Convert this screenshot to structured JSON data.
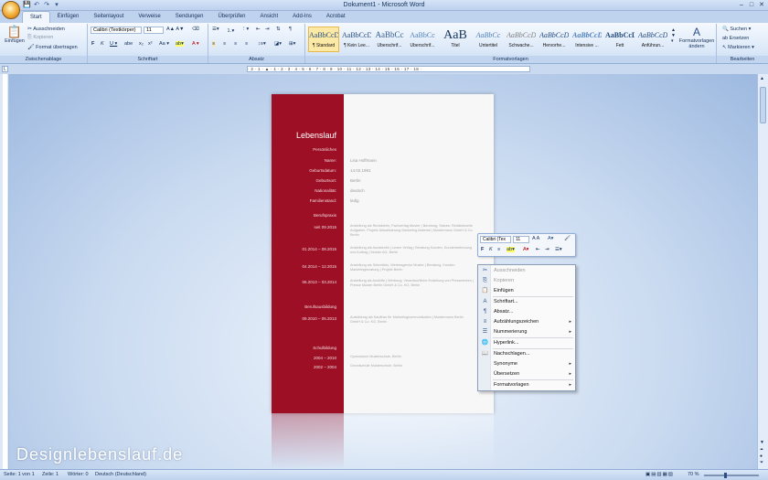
{
  "window": {
    "title": "Dokument1 - Microsoft Word"
  },
  "tabs": [
    "Start",
    "Einfügen",
    "Seitenlayout",
    "Verweise",
    "Sendungen",
    "Überprüfen",
    "Ansicht",
    "Add-Ins",
    "Acrobat"
  ],
  "clipboard": {
    "paste": "Einfügen",
    "cut": "Ausschneiden",
    "copy": "Kopieren",
    "format_painter": "Format übertragen",
    "label": "Zwischenablage"
  },
  "font": {
    "name": "Calibri (Textkörper)",
    "size": "11",
    "label": "Schriftart"
  },
  "paragraph": {
    "label": "Absatz"
  },
  "styles": {
    "label": "Formatvorlagen",
    "items": [
      {
        "preview": "AaBbCcDc",
        "name": "¶ Standard"
      },
      {
        "preview": "AaBbCcDc",
        "name": "¶ Kein Lee..."
      },
      {
        "preview": "AaBbCc",
        "name": "Überschrif..."
      },
      {
        "preview": "AaBbCc",
        "name": "Überschrif..."
      },
      {
        "preview": "AaB",
        "name": "Titel"
      },
      {
        "preview": "AaBbCc",
        "name": "Untertitel"
      },
      {
        "preview": "AaBbCcDc",
        "name": "Schwache..."
      },
      {
        "preview": "AaBbCcDc",
        "name": "Hervorhe..."
      },
      {
        "preview": "AaBbCcDc",
        "name": "Intensive ..."
      },
      {
        "preview": "AaBbCcDc",
        "name": "Fett"
      },
      {
        "preview": "AaBbCcDc",
        "name": "Anführun..."
      }
    ],
    "change": "Formatvorlagen ändern"
  },
  "editing": {
    "find": "Suchen",
    "replace": "Ersetzen",
    "select": "Markieren",
    "label": "Bearbeiten"
  },
  "ruler": "· 2 · 1 · ▲ · 1 · 2 · 3 · 4 · 5 · 6 · 7 · 8 · 9 · 10 · 11 · 12 · 13 · 14 · 15 · 16 · 17 · 18 ·",
  "cv": {
    "title": "Lebenslauf",
    "personal_heading": "Persönliches",
    "personal": [
      {
        "label": "Name:",
        "value": "Lisa Hoffmann"
      },
      {
        "label": "Geburtsdatum:",
        "value": "14.02.1991"
      },
      {
        "label": "Geburtsort:",
        "value": "Berlin"
      },
      {
        "label": "Nationalität:",
        "value": "deutsch"
      },
      {
        "label": "Familienstand:",
        "value": "ledig"
      }
    ],
    "career_heading": "Berufspraxis",
    "career": [
      {
        "date": "seit 09.2015",
        "desc": "Anstellung als Redakterin, Fachverlag Muster | Beratung, Satzes: Redaktionelle Aufgaben, Projekt-Aktualisierung Marketing-Material | Mustermann GmbH & Co. Berlin"
      },
      {
        "date": "01.2014 – 08.2015",
        "desc": "Anstellung als Assistentin | Lesen Verlag | Beratung Kunden, Kundenbetreuung und Auftrag | Muster AG, Berlin"
      },
      {
        "date": "04.2014 – 12.2015",
        "desc": "Anstellung als Sekretärin, Werbeagentur Muster | Beratung, Kunden Marketingberatung | Projekt Berlin"
      },
      {
        "date": "06.2013 – 03.2014",
        "desc": "Anstellung als Aushilfe | Werbung, Verantwortliche Erstellung von Pressetexten | Presse Muster Berlin GmbH & Co. KG, Berlin"
      }
    ],
    "education_heading": "Berufsausbildung",
    "education": [
      {
        "date": "09.2010 – 05.2013",
        "desc": "Ausbildung als Kauffrau für Marketingkommunikation | Mustermann Berlin GmbH & Co. KG, Berlin"
      }
    ],
    "school_heading": "Schulbildung",
    "school": [
      {
        "date": "2004 – 2010",
        "desc": "Gymnasium Musterschule, Berlin"
      },
      {
        "date": "2002 – 2004",
        "desc": "Grundschule Musterschule, Berlin"
      }
    ]
  },
  "mini_toolbar": {
    "font": "Calibri (Tex",
    "size": "11"
  },
  "context_menu": [
    {
      "label": "Ausschneiden",
      "disabled": true,
      "icon": "scissors-icon",
      "glyph": "✂"
    },
    {
      "label": "Kopieren",
      "disabled": true,
      "icon": "copy-icon",
      "glyph": "⎘"
    },
    {
      "label": "Einfügen",
      "disabled": false,
      "icon": "paste-icon",
      "glyph": "📋"
    },
    {
      "label": "Schriftart...",
      "disabled": false,
      "icon": "font-icon",
      "glyph": "A"
    },
    {
      "label": "Absatz...",
      "disabled": false,
      "icon": "paragraph-icon",
      "glyph": "¶"
    },
    {
      "label": "Aufzählungszeichen",
      "disabled": false,
      "icon": "bullets-icon",
      "glyph": "≡",
      "submenu": true
    },
    {
      "label": "Nummerierung",
      "disabled": false,
      "icon": "numbering-icon",
      "glyph": "☰",
      "submenu": true
    },
    {
      "label": "Hyperlink...",
      "disabled": false,
      "icon": "hyperlink-icon",
      "glyph": "🌐"
    },
    {
      "label": "Nachschlagen...",
      "disabled": false,
      "icon": "lookup-icon",
      "glyph": "📖"
    },
    {
      "label": "Synonyme",
      "disabled": false,
      "icon": "",
      "glyph": "",
      "submenu": true
    },
    {
      "label": "Übersetzen",
      "disabled": false,
      "icon": "",
      "glyph": "",
      "submenu": true
    },
    {
      "label": "Formatvorlagen",
      "disabled": false,
      "icon": "",
      "glyph": "",
      "submenu": true
    }
  ],
  "watermark": "Designlebenslauf.de",
  "status": {
    "page": "Seite: 1 von 1",
    "line": "Zeile: 1",
    "words": "Wörter: 0",
    "language": "Deutsch (Deutschland)",
    "zoom": "70 %"
  }
}
